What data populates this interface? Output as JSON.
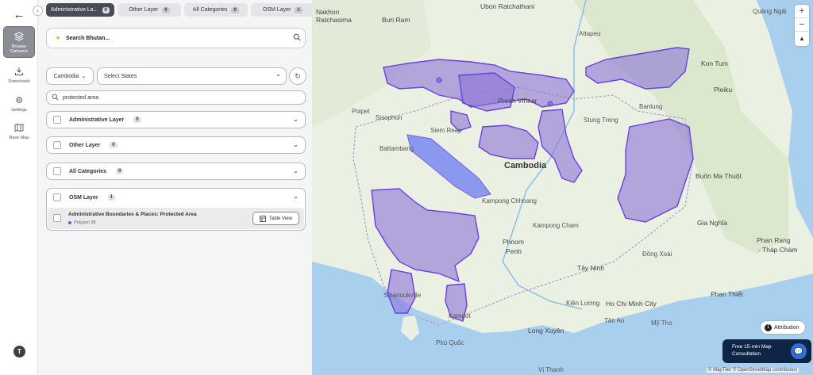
{
  "rail": {
    "back_icon": "arrow-left-icon",
    "items": [
      {
        "label": "Browse Datasets",
        "icon": "layers-icon",
        "active": true
      },
      {
        "label": "Downloads",
        "icon": "download-icon"
      },
      {
        "label": "Settings",
        "icon": "gear-icon"
      },
      {
        "label": "Base Map",
        "icon": "map-icon"
      }
    ],
    "avatar": "T"
  },
  "tabs": [
    {
      "label": "Administrative La...",
      "count": "0",
      "active": true
    },
    {
      "label": "Other Layer",
      "count": "0"
    },
    {
      "label": "All Categories",
      "count": "0"
    },
    {
      "label": "OSM Layer",
      "count": "1"
    }
  ],
  "search": {
    "placeholder": "Search Bhutan..."
  },
  "country": {
    "value": "Cambodia"
  },
  "states": {
    "placeholder": "Select States"
  },
  "filter": {
    "value": "protected area"
  },
  "accordions": [
    {
      "label": "Administrative Layer",
      "count": "0"
    },
    {
      "label": "Other Layer",
      "count": "0"
    },
    {
      "label": "All Categories",
      "count": "0"
    }
  ],
  "osm": {
    "label": "OSM Layer",
    "count": "1",
    "layer_title": "Administrative Boundaries & Places: Protected Area",
    "layer_sub": "Polygon 38",
    "table_view": "Table View"
  },
  "map": {
    "country_label": "Cambodia",
    "labels": [
      {
        "text": "Nakhon",
        "cls": "city"
      },
      {
        "text": "Ratchasima",
        "cls": "city"
      },
      {
        "text": "Buri Ram",
        "cls": "city"
      },
      {
        "text": "Ubon Ratchathani",
        "cls": "city"
      },
      {
        "text": "Quảng Ngãi",
        "cls": ""
      },
      {
        "text": "Attapeu",
        "cls": ""
      },
      {
        "text": "Kon Tum",
        "cls": "city"
      },
      {
        "text": "Pleiku",
        "cls": "city"
      },
      {
        "text": "Preah Vihear",
        "cls": "city"
      },
      {
        "text": "Siem Reap",
        "cls": ""
      },
      {
        "text": "Stung Treng",
        "cls": ""
      },
      {
        "text": "Banlung",
        "cls": ""
      },
      {
        "text": "Poipet",
        "cls": ""
      },
      {
        "text": "Sisophon",
        "cls": ""
      },
      {
        "text": "Battambang",
        "cls": ""
      },
      {
        "text": "Buôn Ma Thuột",
        "cls": "city"
      },
      {
        "text": "Gia Nghĩa",
        "cls": "city"
      },
      {
        "text": "Phnom",
        "cls": "city"
      },
      {
        "text": "Penh",
        "cls": "city"
      },
      {
        "text": "Kampong Cham",
        "cls": ""
      },
      {
        "text": "Tây Ninh",
        "cls": "city"
      },
      {
        "text": "Phan Rang",
        "cls": "city"
      },
      {
        "text": "- Tháp Chàm",
        "cls": "city"
      },
      {
        "text": "Phan Thiết",
        "cls": "city"
      },
      {
        "text": "Ho Chi Minh City",
        "cls": "city"
      },
      {
        "text": "Sihanoukville",
        "cls": ""
      },
      {
        "text": "Kampot",
        "cls": ""
      },
      {
        "text": "Long Xuyên",
        "cls": "city"
      },
      {
        "text": "Tân An",
        "cls": ""
      },
      {
        "text": "Mỹ Tho",
        "cls": ""
      },
      {
        "text": "Phú Quốc",
        "cls": ""
      },
      {
        "text": "Vị Thanh",
        "cls": ""
      },
      {
        "text": "Kiên Lương",
        "cls": ""
      },
      {
        "text": "Kampong Chhnang",
        "cls": ""
      },
      {
        "text": "Đồng Xoài",
        "cls": ""
      }
    ],
    "zoom_in": "+",
    "zoom_out": "−",
    "compass": "▲",
    "attribution_btn": "Attribution",
    "consult_line1": "Free 15-min Map",
    "consult_line2": "Consultation",
    "copyright": "© MapTiler © OpenStreetMap contributors",
    "colors": {
      "land": "#eaf0e2",
      "water": "#9fc8ea",
      "protected_fill": "#8a73d9",
      "protected_stroke": "#6c3fe0",
      "lake": "#7a8af0"
    }
  }
}
